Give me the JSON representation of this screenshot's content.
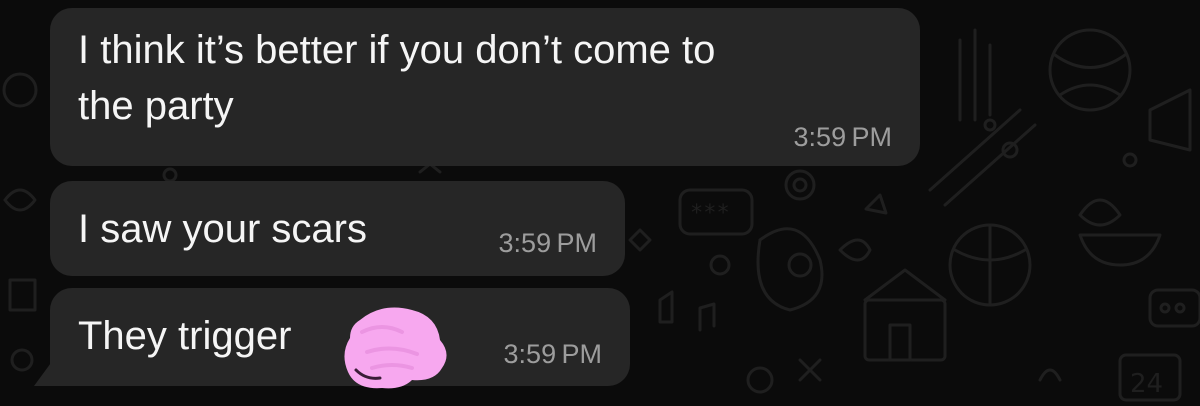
{
  "messages": [
    {
      "text_line1": "I think it’s better if you don’t come to",
      "text_line2": "the party",
      "time": "3:59 PM"
    },
    {
      "text": "I saw your scars",
      "time": "3:59 PM"
    },
    {
      "text": "They trigger",
      "time": "3:59 PM",
      "redaction": "pink scribble"
    }
  ],
  "colors": {
    "background": "#0b0b0b",
    "bubble": "#262626",
    "text": "#f5f5f5",
    "timestamp": "#9d9d9d",
    "redaction": "#f7a8ef",
    "wallpaper_doodles": "#1f1f1f"
  }
}
